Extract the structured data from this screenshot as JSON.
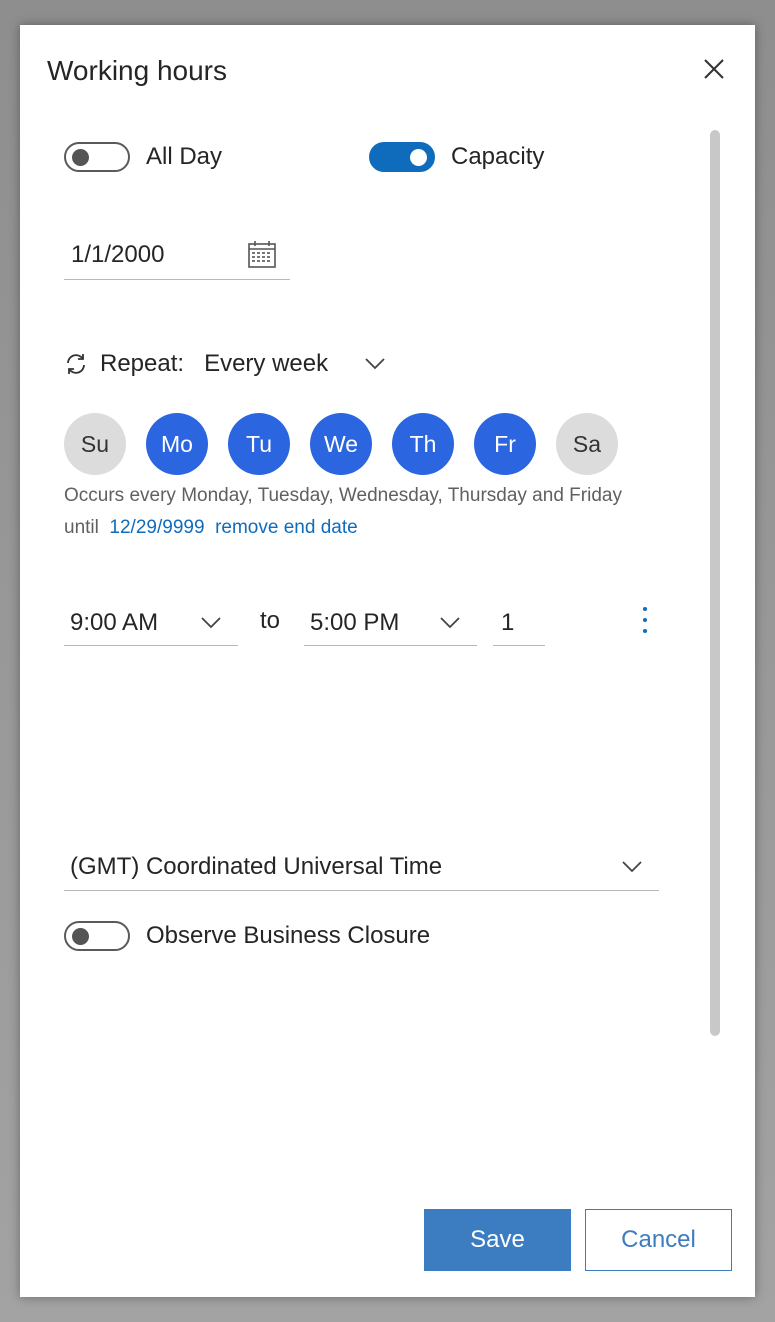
{
  "dialog": {
    "title": "Working hours"
  },
  "toggles": {
    "all_day": {
      "label": "All Day",
      "on": false
    },
    "capacity": {
      "label": "Capacity",
      "on": true
    },
    "business_closure": {
      "label": "Observe Business Closure",
      "on": false
    }
  },
  "date": {
    "value": "1/1/2000"
  },
  "repeat": {
    "label": "Repeat:",
    "value": "Every week"
  },
  "days": [
    {
      "label": "Su",
      "selected": false
    },
    {
      "label": "Mo",
      "selected": true
    },
    {
      "label": "Tu",
      "selected": true
    },
    {
      "label": "We",
      "selected": true
    },
    {
      "label": "Th",
      "selected": true
    },
    {
      "label": "Fr",
      "selected": true
    },
    {
      "label": "Sa",
      "selected": false
    }
  ],
  "occurs": {
    "text": "Occurs every Monday, Tuesday, Wednesday, Thursday and Friday",
    "until_label": "until",
    "end_date": "12/29/9999",
    "remove_link": "remove end date"
  },
  "hours": {
    "start": "9:00 AM",
    "to_label": "to",
    "end": "5:00 PM",
    "capacity": "1"
  },
  "timezone": {
    "value": "(GMT) Coordinated Universal Time"
  },
  "buttons": {
    "save": "Save",
    "cancel": "Cancel"
  },
  "colors": {
    "accent": "#0f6cbd",
    "day_selected": "#2b66e0",
    "day_unselected": "#dcdcdc",
    "button": "#3b7dc0"
  }
}
